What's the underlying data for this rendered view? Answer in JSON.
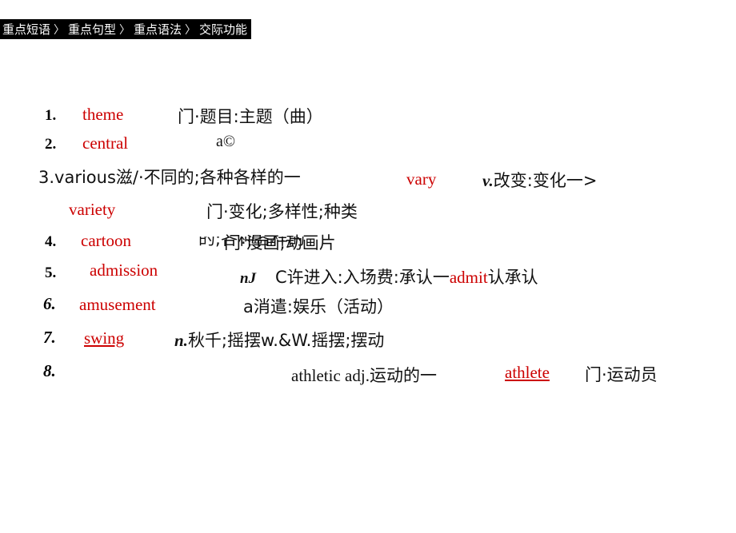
{
  "slide": {
    "background_color": "#ffffff",
    "accent_color": "#cc0000",
    "text_color": "#111111"
  },
  "nav": {
    "background_color": "#000000",
    "text_color": "#ffffff",
    "separator": "〉",
    "crumbs": [
      {
        "label": "重点短语"
      },
      {
        "label": "重点句型"
      },
      {
        "label": "重点语法"
      },
      {
        "label": "交际功能"
      }
    ]
  },
  "vocab": {
    "entries": [
      {
        "number": "1.",
        "word": "theme",
        "gloss": "门·题目:主题（曲）"
      },
      {
        "number": "2.",
        "word": "central",
        "gloss": "a©"
      },
      {
        "number": "3.",
        "run_main": "3.various滋/·不同的;各种各样的一",
        "word2": "vary",
        "gloss2_pos": "v.",
        "gloss2": "改变:变化一>",
        "word3": "variety",
        "gloss3": "门·变化;多样性;种类",
        "artifact": "的;各种各样的"
      },
      {
        "number": "4.",
        "word": "cartoon",
        "gloss": "门·漫画;动画片"
      },
      {
        "number": "5.",
        "word": "admission",
        "gloss_pos": "nJ",
        "gloss_a": "C许进入:入场费:承认一",
        "gloss_red": "admit",
        "gloss_b": "认承认"
      },
      {
        "number": "6.",
        "word": "amusement",
        "gloss": "a消遣:娱乐（活动）"
      },
      {
        "number": "7.",
        "word": "swing",
        "gloss_pos": "n.",
        "gloss": "秋千;摇摆w.&W.摇摆;摆动"
      },
      {
        "number": "8.",
        "gloss_a": "athletic adj.运动的一",
        "word_red": "athlete",
        "gloss_b": "门·运动员"
      }
    ]
  }
}
